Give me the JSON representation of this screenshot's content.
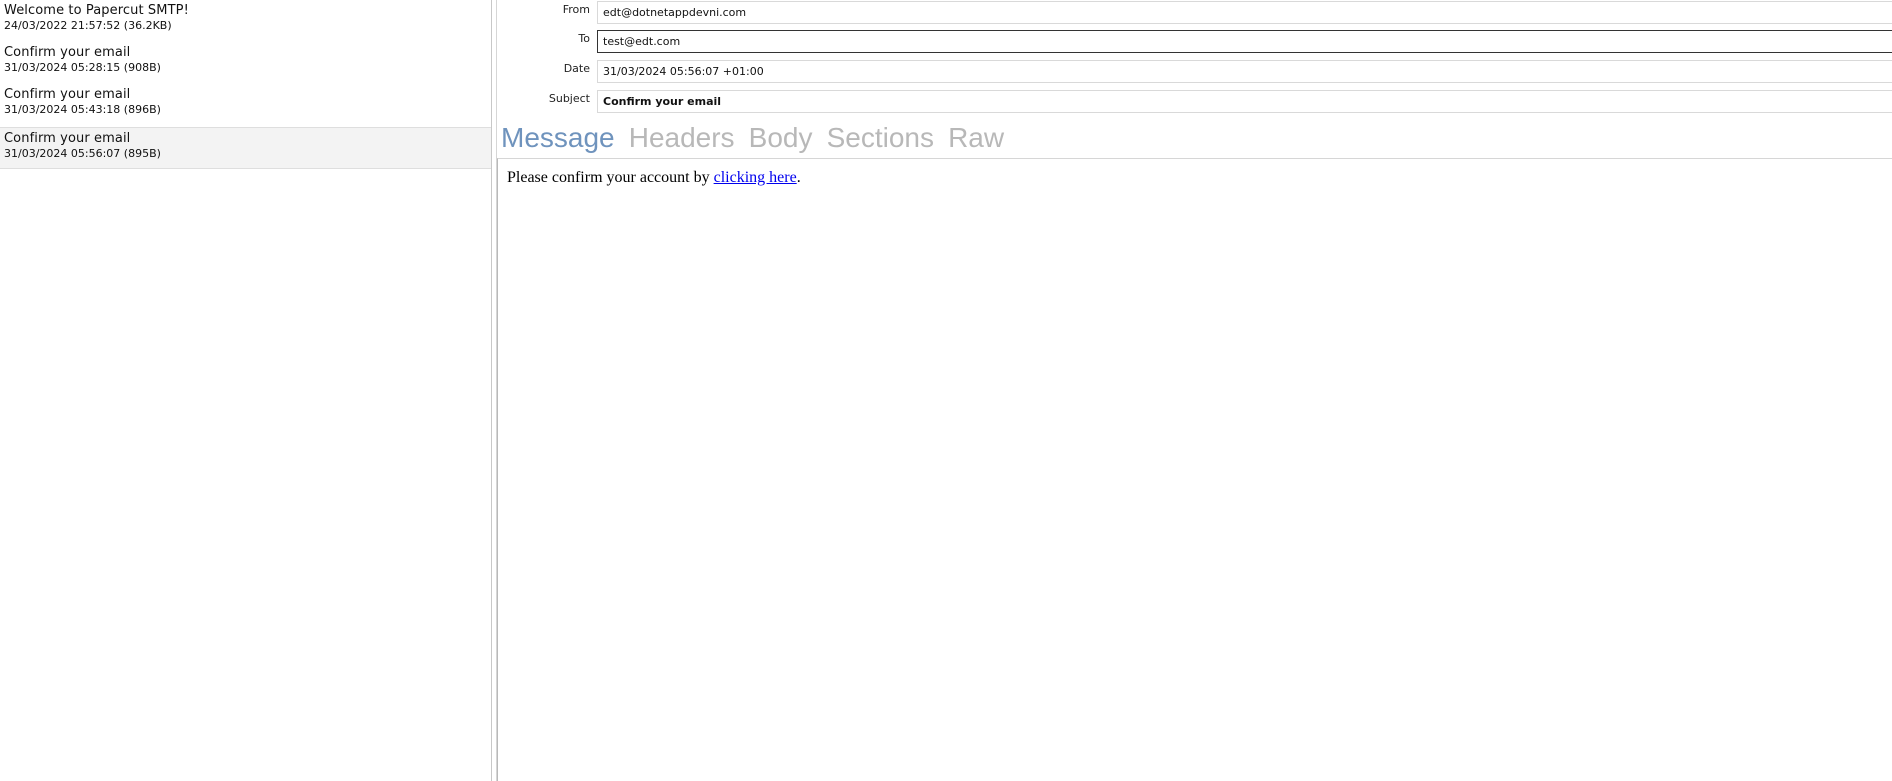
{
  "messages": [
    {
      "subject": "Welcome to Papercut SMTP!",
      "meta": "24/03/2022 21:57:52 (36.2KB)"
    },
    {
      "subject": "Confirm your email",
      "meta": "31/03/2024 05:28:15 (908B)"
    },
    {
      "subject": "Confirm your email",
      "meta": "31/03/2024 05:43:18 (896B)"
    },
    {
      "subject": "Confirm your email",
      "meta": "31/03/2024 05:56:07 (895B)"
    }
  ],
  "header": {
    "from_label": "From",
    "from_value": "edt@dotnetappdevni.com",
    "to_label": "To",
    "to_value": "test@edt.com",
    "date_label": "Date",
    "date_value": "31/03/2024 05:56:07 +01:00",
    "subject_label": "Subject",
    "subject_value": "Confirm your email"
  },
  "tabs": [
    {
      "label": "Message"
    },
    {
      "label": "Headers"
    },
    {
      "label": "Body"
    },
    {
      "label": "Sections"
    },
    {
      "label": "Raw"
    }
  ],
  "body": {
    "text_before": "Please confirm your account by ",
    "link_text": "clicking here",
    "text_after": "."
  },
  "colors": {
    "active_tab": "#6f93bd",
    "inactive_tab": "#b8b8b8",
    "selected_row": "#f3f3f3",
    "link": "#0000ee"
  }
}
